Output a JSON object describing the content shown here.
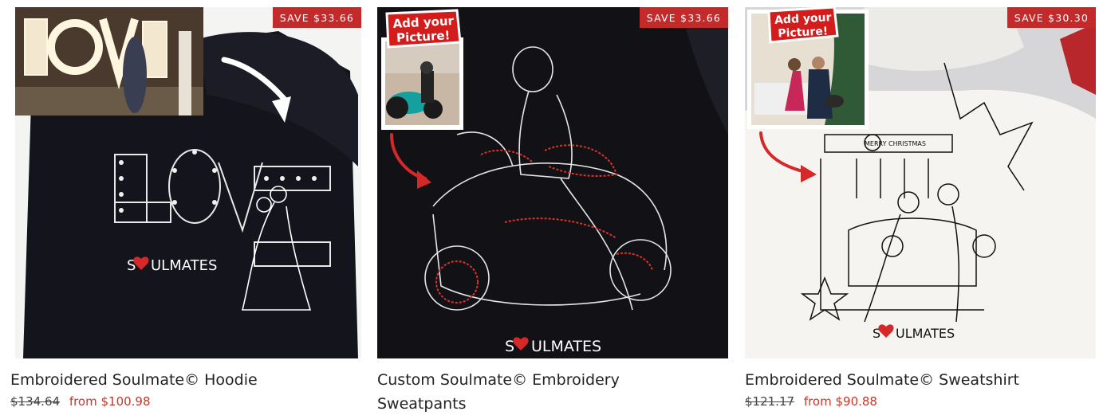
{
  "colors": {
    "badge_bg": "#c52a2a",
    "sale_price": "#c0392b",
    "title_text": "#222222",
    "brand_heart": "#d62828"
  },
  "products": [
    {
      "title": "Embroidered Soulmate© Hoodie",
      "badge": "SAVE $33.66",
      "price_old": "$134.64",
      "price_from": "from $100.98",
      "image": {
        "garment": "black hoodie",
        "embroidery_brand": "SOULMATES",
        "inset_sign": "LOVE",
        "icons": [
          "photo-inset",
          "curved-arrow-icon"
        ]
      }
    },
    {
      "title": "Custom Soulmate© Embroidery Sweatpants",
      "badge": "SAVE $33.66",
      "price_old": "",
      "price_from": "",
      "image": {
        "garment": "black sweatpants",
        "embroidery_brand": "SOULMATES",
        "sticker_line_1": "Add your",
        "sticker_line_2": "Picture!",
        "icons": [
          "photo-inset",
          "red-arrow-icon"
        ]
      }
    },
    {
      "title": "Embroidered Soulmate© Sweatshirt",
      "badge": "SAVE $30.30",
      "price_old": "$121.17",
      "price_from": "from $90.88",
      "image": {
        "garment": "white sweatshirt",
        "embroidery_brand": "SOULMATES",
        "banner_text": "MERRY CHRISTMAS",
        "sticker_line_1": "Add your",
        "sticker_line_2": "Picture!",
        "icons": [
          "photo-inset",
          "red-arrow-icon"
        ]
      }
    }
  ]
}
